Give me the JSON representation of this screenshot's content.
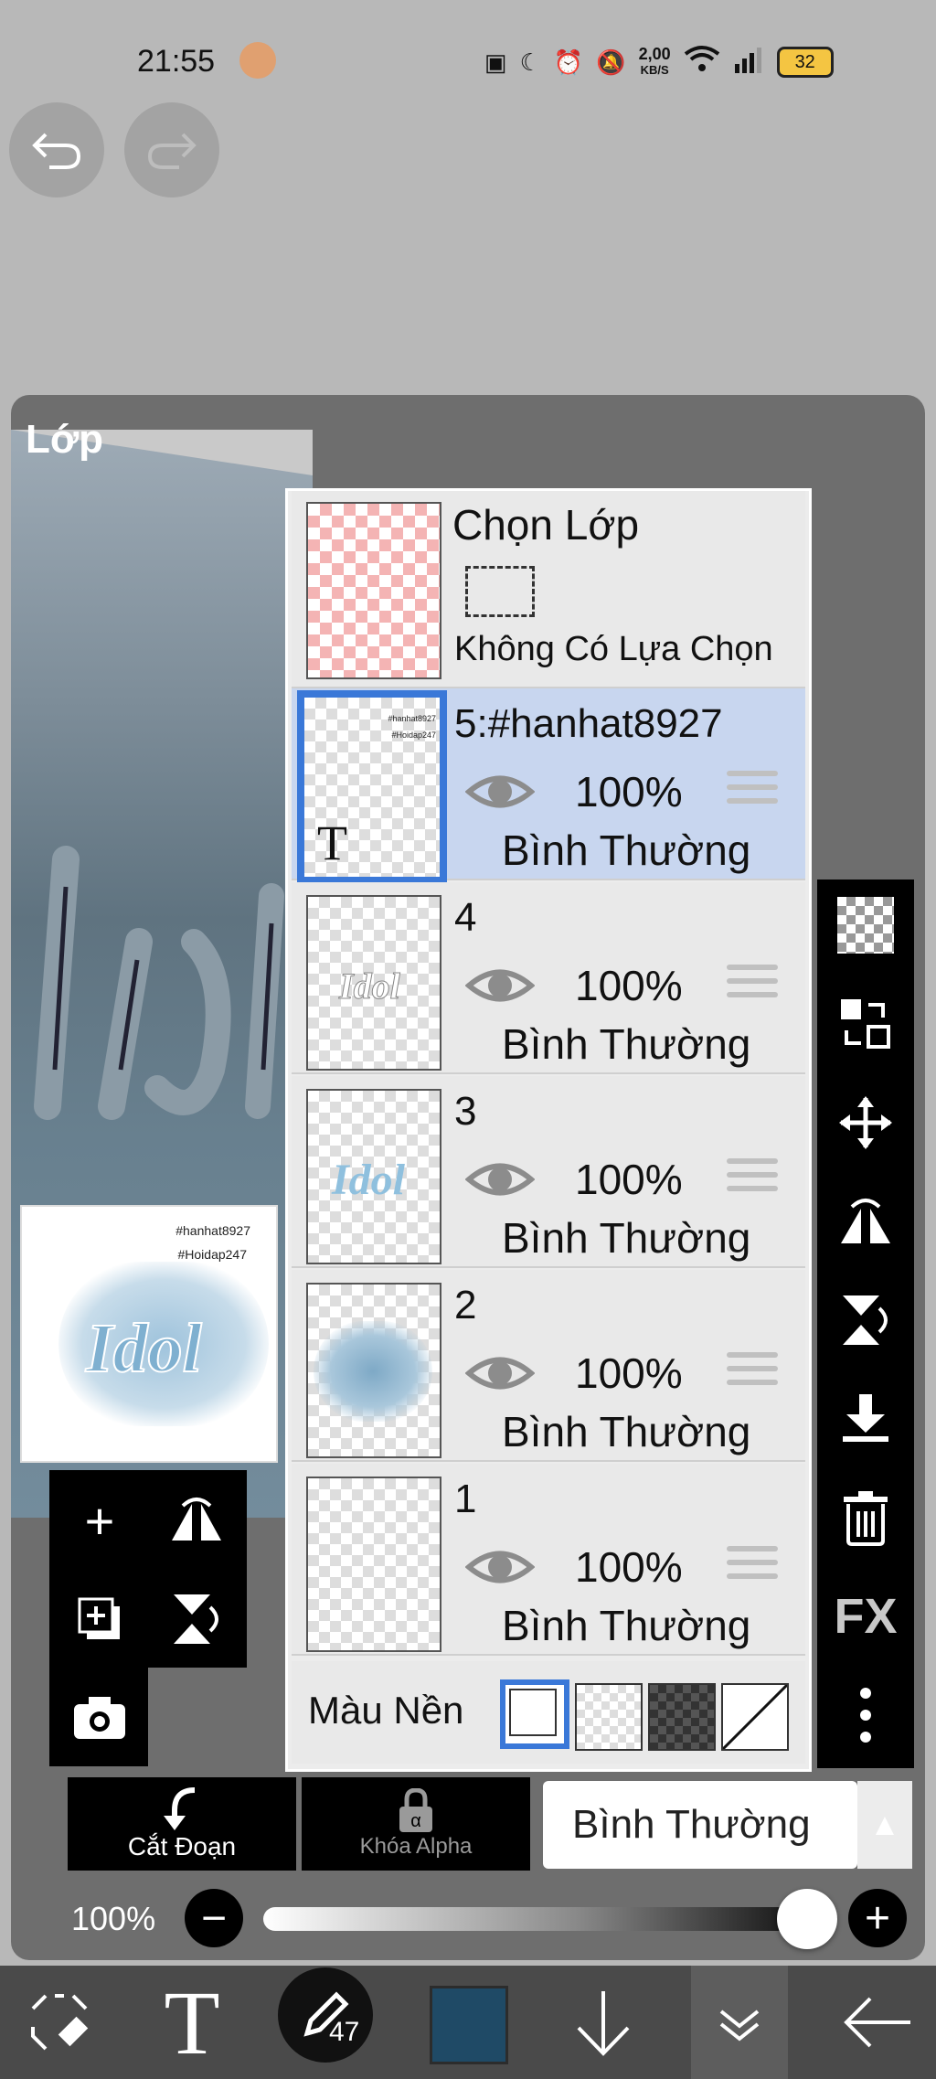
{
  "status_bar": {
    "time": "21:55",
    "network_speed_top": "2,00",
    "network_speed_unit": "KB/S",
    "battery": "32"
  },
  "panel": {
    "title": "Lớp"
  },
  "thumbnail": {
    "tag1": "#hanhat8927",
    "tag2": "#Hoidap247",
    "art_text": "Idol"
  },
  "selection_layer": {
    "title": "Chọn Lớp",
    "subtitle": "Không Có Lựa Chọn"
  },
  "layers": [
    {
      "name": "5:#hanhat8927",
      "opacity": "100%",
      "blend": "Bình Thường",
      "selected": true,
      "thumb_text": "T"
    },
    {
      "name": "4",
      "opacity": "100%",
      "blend": "Bình Thường",
      "selected": false,
      "thumb_text": "Idol"
    },
    {
      "name": "3",
      "opacity": "100%",
      "blend": "Bình Thường",
      "selected": false,
      "thumb_text": "Idol"
    },
    {
      "name": "2",
      "opacity": "100%",
      "blend": "Bình Thường",
      "selected": false,
      "thumb_text": ""
    },
    {
      "name": "1",
      "opacity": "100%",
      "blend": "Bình Thường",
      "selected": false,
      "thumb_text": ""
    }
  ],
  "background": {
    "label": "Màu Nền"
  },
  "right_toolbar": {
    "fx_label": "FX"
  },
  "controls": {
    "clip_label": "Cắt Đoạn",
    "alpha_lock_label": "Khóa Alpha",
    "blend_mode": "Bình Thường",
    "opacity_label": "100%",
    "opacity_value": 1.0
  },
  "bottom_toolbar": {
    "brush_size": "47",
    "text_tool_glyph": "T",
    "current_color": "#1f4a66"
  },
  "colors": {
    "accent": "#3a78d8",
    "selected_row": "#c8d6ef"
  }
}
